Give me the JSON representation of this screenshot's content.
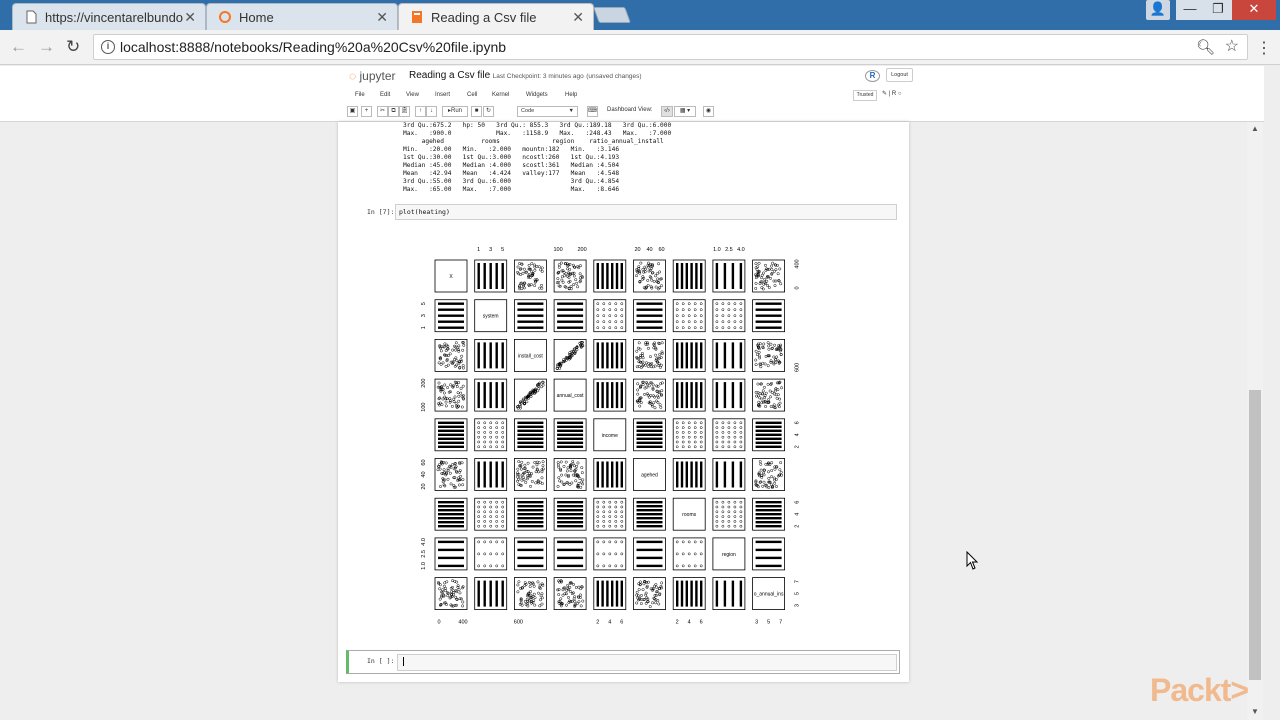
{
  "browser": {
    "tabs": [
      {
        "label": "https://vincentarelbundo",
        "icon": "document-icon"
      },
      {
        "label": "Home",
        "icon": "jupyter-icon"
      },
      {
        "label": "Reading a Csv file",
        "icon": "notebook-icon",
        "active": true
      }
    ],
    "url": "localhost:8888/notebooks/Reading%20a%20Csv%20file.ipynb"
  },
  "jupyter": {
    "logo": "jupyter",
    "notebook_name": "Reading a Csv file",
    "checkpoint": "Last Checkpoint: 3 minutes ago",
    "unsaved": "(unsaved changes)",
    "logout": "Logout",
    "menus": [
      "File",
      "Edit",
      "View",
      "Insert",
      "Cell",
      "Kernel",
      "Widgets",
      "Help"
    ],
    "trusted": "Trusted",
    "kernel": "R",
    "run_label": "Run",
    "cell_type": "Code",
    "dashboard_label": "Dashboard View:"
  },
  "cells": {
    "summary_output": "3rd Qu.:675.2   hp: 50   3rd Qu.: 855.3   3rd Qu.:189.18   3rd Qu.:6.000  \nMax.   :900.0            Max.   :1158.9   Max.   :248.43   Max.   :7.000  \n     agehed          rooms              region    ratio_annual_install\nMin.   :20.00   Min.   :2.000   mountn:182   Min.   :3.146  \n1st Qu.:30.00   1st Qu.:3.000   ncostl:260   1st Qu.:4.193  \nMedian :45.00   Median :4.000   scostl:361   Median :4.504  \nMean   :42.94   Mean   :4.424   valley:177   Mean   :4.548  \n3rd Qu.:55.00   3rd Qu.:6.000                3rd Qu.:4.854  \nMax.   :65.00   Max.   :7.000                Max.   :8.646  ",
    "plot_prompt": "In [7]:",
    "plot_code": "plot(heating)",
    "empty_prompt": "In [ ]:"
  },
  "chart_data": {
    "type": "scatter",
    "title": "",
    "variables": [
      "X",
      "system",
      "install_cost",
      "annual_cost",
      "income",
      "agehed",
      "rooms",
      "region",
      "o_annual_ins"
    ],
    "top_axis_ticks": [
      [
        "1",
        "3",
        "5"
      ],
      [
        "100",
        "200"
      ],
      [
        "20",
        "40",
        "60"
      ],
      [
        "1.0",
        "2.5",
        "4.0"
      ]
    ],
    "bottom_axis_ticks": [
      [
        "0",
        "400"
      ],
      [
        "600"
      ],
      [
        "2",
        "4",
        "6"
      ],
      [
        "2",
        "4",
        "6"
      ],
      [
        "3",
        "5",
        "7"
      ]
    ],
    "left_axis_ticks": [
      [
        "1",
        "3",
        "5"
      ],
      [
        "100",
        "200"
      ],
      [
        "20",
        "40",
        "60"
      ],
      [
        "1.0",
        "2.5",
        "4.0"
      ]
    ],
    "right_axis_ticks": [
      [
        "0",
        "400"
      ],
      [
        "600"
      ],
      [
        "2",
        "4",
        "6"
      ],
      [
        "2",
        "4",
        "6"
      ],
      [
        "3",
        "5",
        "7"
      ]
    ]
  },
  "watermark": "Packt>"
}
